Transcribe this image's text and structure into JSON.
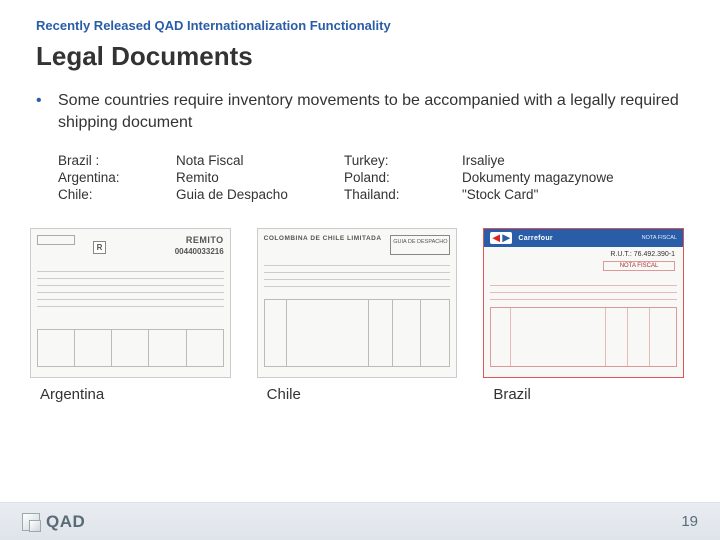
{
  "pre_title": "Recently Released QAD Internationalization Functionality",
  "title": "Legal Documents",
  "bullet": "Some countries require inventory movements to be accompanied with a legally required shipping document",
  "countries_left": {
    "labels": [
      "Brazil :",
      "Argentina:",
      "Chile:"
    ],
    "docs": [
      "Nota Fiscal",
      "Remito",
      "Guia de Despacho"
    ]
  },
  "countries_right": {
    "labels": [
      "Turkey:",
      "Poland:",
      "Thailand:"
    ],
    "docs": [
      "Irsaliye",
      "Dokumenty magazynowe",
      "\"Stock Card\""
    ]
  },
  "sample_docs": {
    "argentina": {
      "remito_label": "REMITO",
      "r_mark": "R",
      "number": "00440033216"
    },
    "chile": {
      "company": "COLOMBINA DE CHILE LIMITADA",
      "doc_title": "GUIA DE DESPACHO"
    },
    "brazil": {
      "brand": "Carrefour",
      "rut": "R.U.T.: 76.492.390-1",
      "doc_title": "NOTA FISCAL"
    }
  },
  "captions": [
    "Argentina",
    "Chile",
    "Brazil"
  ],
  "footer": {
    "brand": "QAD",
    "page": "19"
  }
}
